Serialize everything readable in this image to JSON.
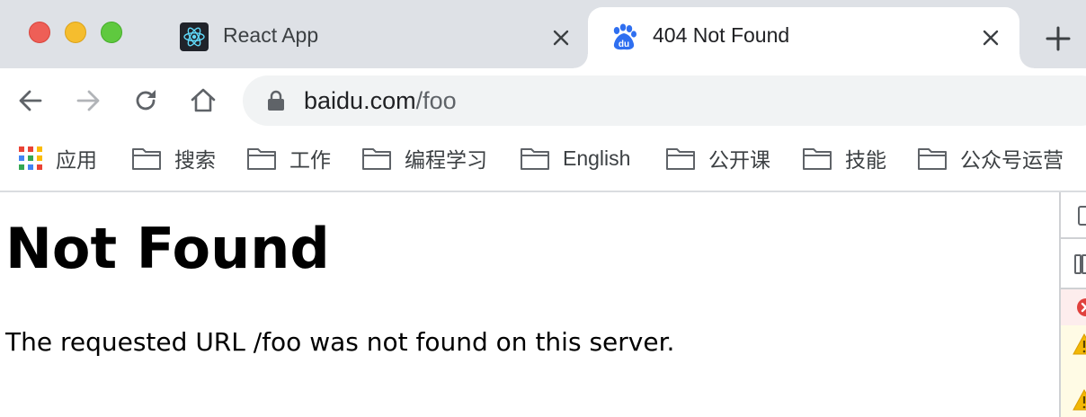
{
  "browser": {
    "tabs": [
      {
        "title": "React App",
        "favicon": "react-icon",
        "active": false
      },
      {
        "title": "404 Not Found",
        "favicon": "baidu-icon",
        "active": true
      }
    ],
    "new_tab_icon": "plus-icon",
    "url": {
      "host": "baidu.com",
      "path": "/foo"
    },
    "bookmarks": [
      {
        "label": "应用",
        "icon": "apps-grid-icon"
      },
      {
        "label": "搜索",
        "icon": "folder-icon"
      },
      {
        "label": "工作",
        "icon": "folder-icon"
      },
      {
        "label": "编程学习",
        "icon": "folder-icon"
      },
      {
        "label": "English",
        "icon": "folder-icon"
      },
      {
        "label": "公开课",
        "icon": "folder-icon"
      },
      {
        "label": "技能",
        "icon": "folder-icon"
      },
      {
        "label": "公众号运营",
        "icon": "folder-icon"
      }
    ]
  },
  "page": {
    "heading": "Not Found",
    "message": "The requested URL /foo was not found on this server."
  },
  "colors": {
    "tab_strip": "#dee1e6",
    "traffic_close": "#ee5f57",
    "traffic_minimize": "#f5bd2e",
    "traffic_maximize": "#5fc93f",
    "baidu_blue": "#2f6ff0",
    "error_red": "#e0413d",
    "warning_yellow": "#f2b705"
  }
}
